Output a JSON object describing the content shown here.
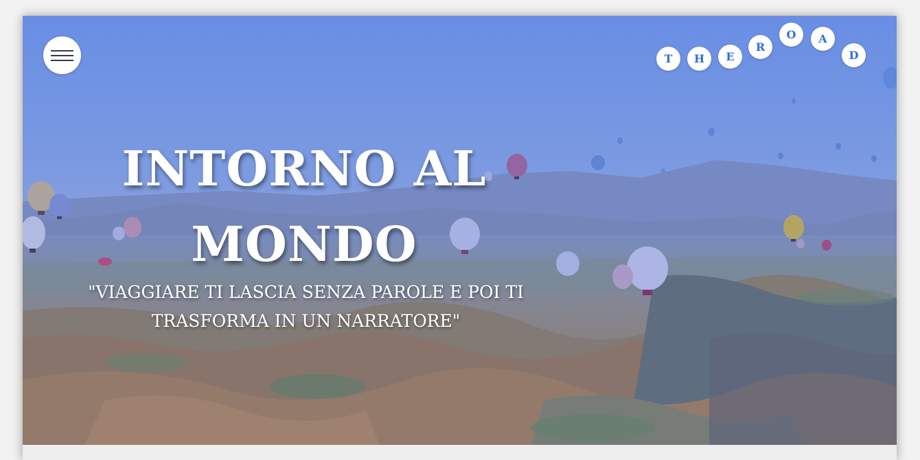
{
  "hero": {
    "title": "INTORNO AL MONDO",
    "subtitle": "\"VIAGGIARE TI LASCIA SENZA PAROLE E POI TI TRASFORMA IN UN NARRATORE\"",
    "background": "hot-air-balloons-over-valley-photo"
  },
  "logo": {
    "letters": [
      "T",
      "H",
      "E",
      "R",
      "O",
      "A",
      "D"
    ],
    "color": "#2f6fd8"
  },
  "menu": {
    "icon": "hamburger-menu-icon"
  },
  "colors": {
    "overlay": "#3c5ad2",
    "accent": "#2f6fd8"
  }
}
